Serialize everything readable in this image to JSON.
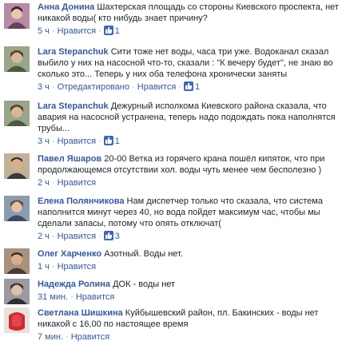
{
  "like_label": "Нравится",
  "comments": [
    {
      "author": "Анна Донина",
      "text": "Шахтерская площадь со стороны Киевского проспекта, нет никакой воды( кто нибудь знает причину?",
      "time": "5 ч",
      "edited": "",
      "likes": "1",
      "avatar_icon": "user-photo",
      "avatar_color": "#a06a8a"
    },
    {
      "author": "Lara Stepanchuk",
      "text": "Сити тоже нет воды, часа три уже. Водоканал сказал выбило у них на насосной что-то, сказали : \"К вечеру будет\", не знаю во сколько это... Теперь у них оба телефона хронически заняты",
      "time": "3 ч",
      "edited": "Отредактировано",
      "likes": "1",
      "avatar_icon": "user-photo",
      "avatar_color": "#7f8a6a"
    },
    {
      "author": "Lara Stepanchuk",
      "text": "Дежурный исполкома Киевского района сказала, что авария на насосной устранена, теперь надо подождать пока наполнятся трубы...",
      "time": "3 ч",
      "edited": "",
      "likes": "1",
      "avatar_icon": "user-photo",
      "avatar_color": "#7f8a6a"
    },
    {
      "author": "Павел Яшаров",
      "text": "20-00 Ветка из горячего крана пошёл кипяток, что при продолжающемся отсутствии хол. воды чуть менее чем бесполезно )",
      "time": "2 ч",
      "edited": "",
      "likes": "",
      "avatar_icon": "user-photo",
      "avatar_color": "#9a7a5a"
    },
    {
      "author": "Елена Полянчикова",
      "text": "Нам диспетчер только что сказала, что система наполнится минут через 40, но вода пойдет максимум час, чтобы мы сделали запасы, потому что опять отключат(",
      "time": "2 ч",
      "edited": "",
      "likes": "3",
      "avatar_icon": "user-photo",
      "avatar_color": "#6d7a8f"
    },
    {
      "author": "Олег Харченко",
      "text": "Азотный. Воды нет.",
      "time": "1 ч",
      "edited": "",
      "likes": "",
      "avatar_icon": "user-photo",
      "avatar_color": "#8c6f5a"
    },
    {
      "author": "Надежда Ролина",
      "text": "ДОК - воды нет",
      "time": "31 мин.",
      "edited": "",
      "likes": "",
      "avatar_icon": "user-photo",
      "avatar_color": "#6a6a72"
    },
    {
      "author": "Светлана Шишкина",
      "text": "Куйбышевский район, пл. Бакинских - воды нет никакой с 16,00 по настоящее время",
      "time": "7 мин.",
      "edited": "",
      "likes": "",
      "avatar_icon": "user-photo",
      "avatar_color": "#c7353a"
    }
  ]
}
